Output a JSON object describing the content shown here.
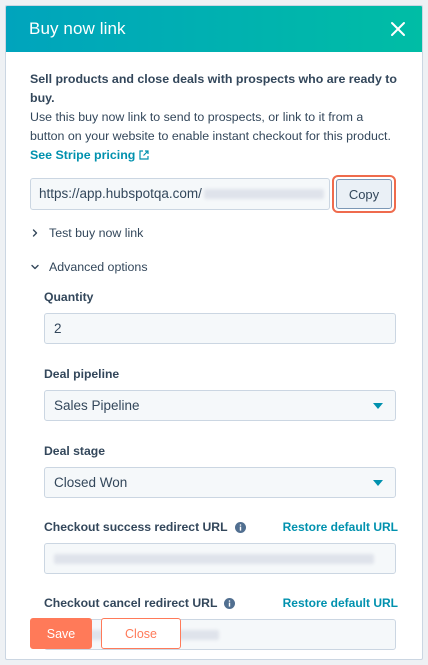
{
  "header": {
    "title": "Buy now link"
  },
  "intro": {
    "strong": "Sell products and close deals with prospects who are ready to buy.",
    "text": "Use this buy now link to send to prospects, or link to it from a button on your website to enable instant checkout for this product. ",
    "link": "See Stripe pricing"
  },
  "url": {
    "value": "https://app.hubspotqa.com/",
    "copy_label": "Copy"
  },
  "toggles": {
    "test": "Test buy now link",
    "advanced": "Advanced options"
  },
  "fields": {
    "quantity": {
      "label": "Quantity",
      "value": "2"
    },
    "pipeline": {
      "label": "Deal pipeline",
      "value": "Sales Pipeline"
    },
    "stage": {
      "label": "Deal stage",
      "value": "Closed Won"
    },
    "success": {
      "label": "Checkout success redirect URL",
      "restore": "Restore default URL"
    },
    "cancel": {
      "label": "Checkout cancel redirect URL",
      "restore": "Restore default URL"
    }
  },
  "footer": {
    "save": "Save",
    "close": "Close"
  },
  "colors": {
    "accent": "#ff7a59",
    "link": "#0091ae",
    "header_start": "#00a4bd",
    "header_end": "#00bda5"
  }
}
